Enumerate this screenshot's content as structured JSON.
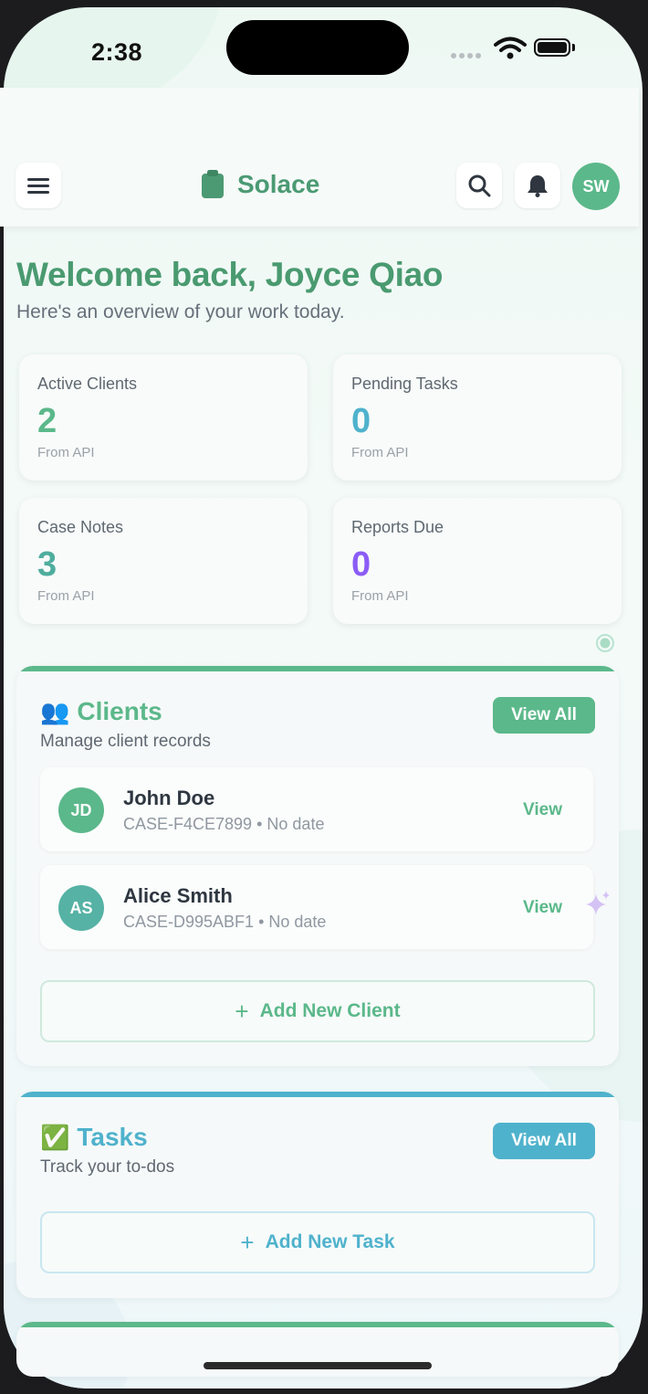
{
  "status_bar": {
    "time": "2:38"
  },
  "header": {
    "brand": "Solace",
    "avatar_initials": "SW",
    "icons": [
      "menu-icon",
      "clipboard-icon",
      "search-icon",
      "bell-icon"
    ]
  },
  "welcome": {
    "title": "Welcome back, Joyce Qiao",
    "subtitle": "Here's an overview of your work today."
  },
  "stats": [
    {
      "label": "Active Clients",
      "value": "2",
      "source": "From API",
      "color": "#5bb88a"
    },
    {
      "label": "Pending Tasks",
      "value": "0",
      "source": "From API",
      "color": "#4fb2cc"
    },
    {
      "label": "Case Notes",
      "value": "3",
      "source": "From API",
      "color": "#4fad9e"
    },
    {
      "label": "Reports Due",
      "value": "0",
      "source": "From API",
      "color": "#8b5cf6"
    }
  ],
  "clients_section": {
    "emoji": "👥",
    "title": "Clients",
    "subtitle": "Manage client records",
    "view_all": "View All",
    "accent": "#5bb88a",
    "clients": [
      {
        "initials": "JD",
        "name": "John Doe",
        "case_id": "CASE-F4CE7899",
        "date": "No date",
        "action": "View",
        "avatar_color": "#5bb88a"
      },
      {
        "initials": "AS",
        "name": "Alice Smith",
        "case_id": "CASE-D995ABF1",
        "date": "No date",
        "action": "View",
        "avatar_color": "#56b2a4"
      }
    ],
    "add_label": "Add New Client"
  },
  "tasks_section": {
    "emoji": "✅",
    "title": "Tasks",
    "subtitle": "Track your to-dos",
    "view_all": "View All",
    "accent": "#4fb2cc",
    "add_label": "Add New Task"
  }
}
